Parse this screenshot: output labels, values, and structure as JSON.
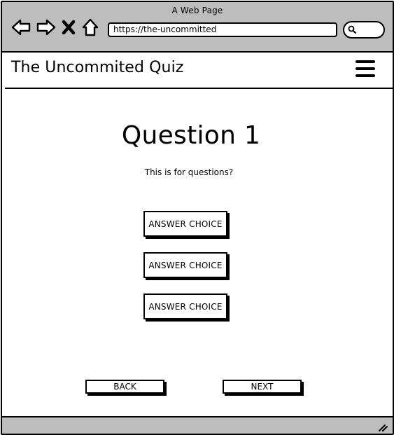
{
  "browser": {
    "window_title": "A Web Page",
    "url": "https://the-uncommitted",
    "icons": {
      "back": "back-arrow-icon",
      "forward": "forward-arrow-icon",
      "stop": "close-x-icon",
      "home": "home-icon",
      "search": "search-icon",
      "resize": "resize-grip-icon"
    }
  },
  "header": {
    "title": "The Uncommited Quiz",
    "menu_icon": "hamburger-menu-icon"
  },
  "quiz": {
    "question_title": "Question 1",
    "question_text": "This is for questions?",
    "answers": [
      {
        "label": "ANSWER CHOICE"
      },
      {
        "label": "ANSWER CHOICE"
      },
      {
        "label": "ANSWER CHOICE"
      }
    ]
  },
  "footer": {
    "back_label": "BACK",
    "next_label": "NEXT"
  },
  "colors": {
    "chrome": "#bdbdbd",
    "ink": "#000000",
    "surface": "#ffffff"
  }
}
